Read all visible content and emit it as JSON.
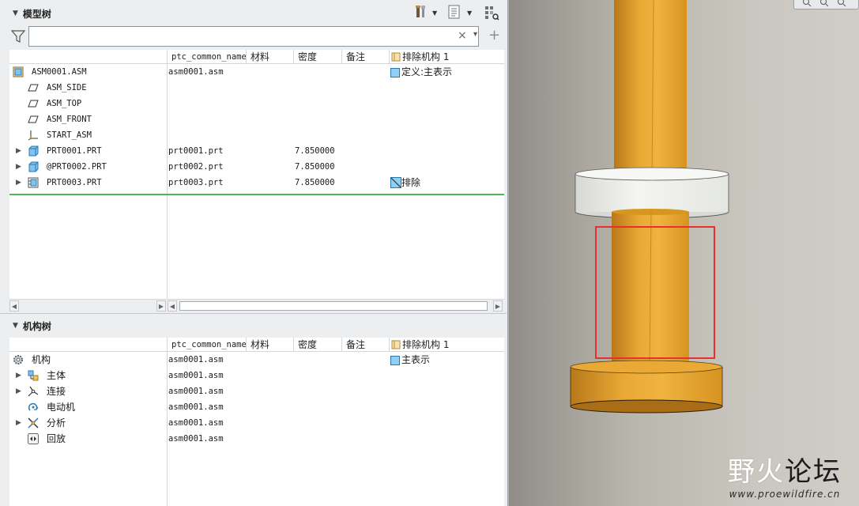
{
  "model_tree": {
    "title": "模型树",
    "columns": [
      "ptc_common_name",
      "材料",
      "密度",
      "备注",
      "排除机构 1"
    ],
    "rows": [
      {
        "name": "ASM0001.ASM",
        "icon": "assembly-icon",
        "expander": "",
        "common_name": "asm0001.asm",
        "material": "",
        "density": "",
        "note": "",
        "exclude": "定义:主表示",
        "exclude_icon": "representation-icon"
      },
      {
        "name": "ASM_SIDE",
        "icon": "datum-plane-icon",
        "expander": "",
        "common_name": "",
        "material": "",
        "density": "",
        "note": "",
        "exclude": "",
        "exclude_icon": ""
      },
      {
        "name": "ASM_TOP",
        "icon": "datum-plane-icon",
        "expander": "",
        "common_name": "",
        "material": "",
        "density": "",
        "note": "",
        "exclude": "",
        "exclude_icon": ""
      },
      {
        "name": "ASM_FRONT",
        "icon": "datum-plane-icon",
        "expander": "",
        "common_name": "",
        "material": "",
        "density": "",
        "note": "",
        "exclude": "",
        "exclude_icon": ""
      },
      {
        "name": "START_ASM",
        "icon": "coordinate-system-icon",
        "expander": "",
        "common_name": "",
        "material": "",
        "density": "",
        "note": "",
        "exclude": "",
        "exclude_icon": ""
      },
      {
        "name": "PRT0001.PRT",
        "icon": "part-icon",
        "expander": "▶",
        "common_name": "prt0001.prt",
        "material": "",
        "density": "7.850000",
        "note": "",
        "exclude": "",
        "exclude_icon": ""
      },
      {
        "name": "@PRT0002.PRT",
        "icon": "part-icon",
        "expander": "▶",
        "common_name": "prt0002.prt",
        "material": "",
        "density": "7.850000",
        "note": "",
        "exclude": "",
        "exclude_icon": ""
      },
      {
        "name": "PRT0003.PRT",
        "icon": "excluded-part-icon",
        "expander": "▶",
        "common_name": "prt0003.prt",
        "material": "",
        "density": "7.850000",
        "note": "",
        "exclude": "排除",
        "exclude_icon": "exclude-icon"
      }
    ]
  },
  "search": {
    "value": "",
    "placeholder": "",
    "clear_glyph": "×"
  },
  "toolbar": {
    "add_glyph": "+",
    "dropdown_glyph": "▾"
  },
  "mechanism_tree": {
    "title": "机构树",
    "columns": [
      "ptc_common_name",
      "材料",
      "密度",
      "备注",
      "排除机构 1"
    ],
    "rows": [
      {
        "name": "机构",
        "icon": "mechanism-gear-icon",
        "expander": "",
        "common_name": "asm0001.asm",
        "exclude": "主表示",
        "exclude_icon": "representation-icon"
      },
      {
        "name": "主体",
        "icon": "bodies-icon",
        "expander": "▶",
        "common_name": "asm0001.asm",
        "exclude": "",
        "exclude_icon": ""
      },
      {
        "name": "连接",
        "icon": "connections-icon",
        "expander": "▶",
        "common_name": "asm0001.asm",
        "exclude": "",
        "exclude_icon": ""
      },
      {
        "name": "电动机",
        "icon": "motor-icon",
        "expander": "",
        "common_name": "asm0001.asm",
        "exclude": "",
        "exclude_icon": ""
      },
      {
        "name": "分析",
        "icon": "analysis-icon",
        "expander": "▶",
        "common_name": "asm0001.asm",
        "exclude": "",
        "exclude_icon": ""
      },
      {
        "name": "回放",
        "icon": "playback-icon",
        "expander": "",
        "common_name": "asm0001.asm",
        "exclude": "",
        "exclude_icon": ""
      }
    ]
  },
  "watermark": {
    "title_part1": "野火",
    "title_part2": "论坛",
    "url": "www.proewildfire.cn"
  },
  "colors": {
    "part_gold": "#e3a02b",
    "part_white": "#f0f1ee",
    "highlight_red": "#e8312f",
    "tree_bg": "#ffffff",
    "panel_bg": "#eceef0",
    "separator_green": "#55b455"
  }
}
